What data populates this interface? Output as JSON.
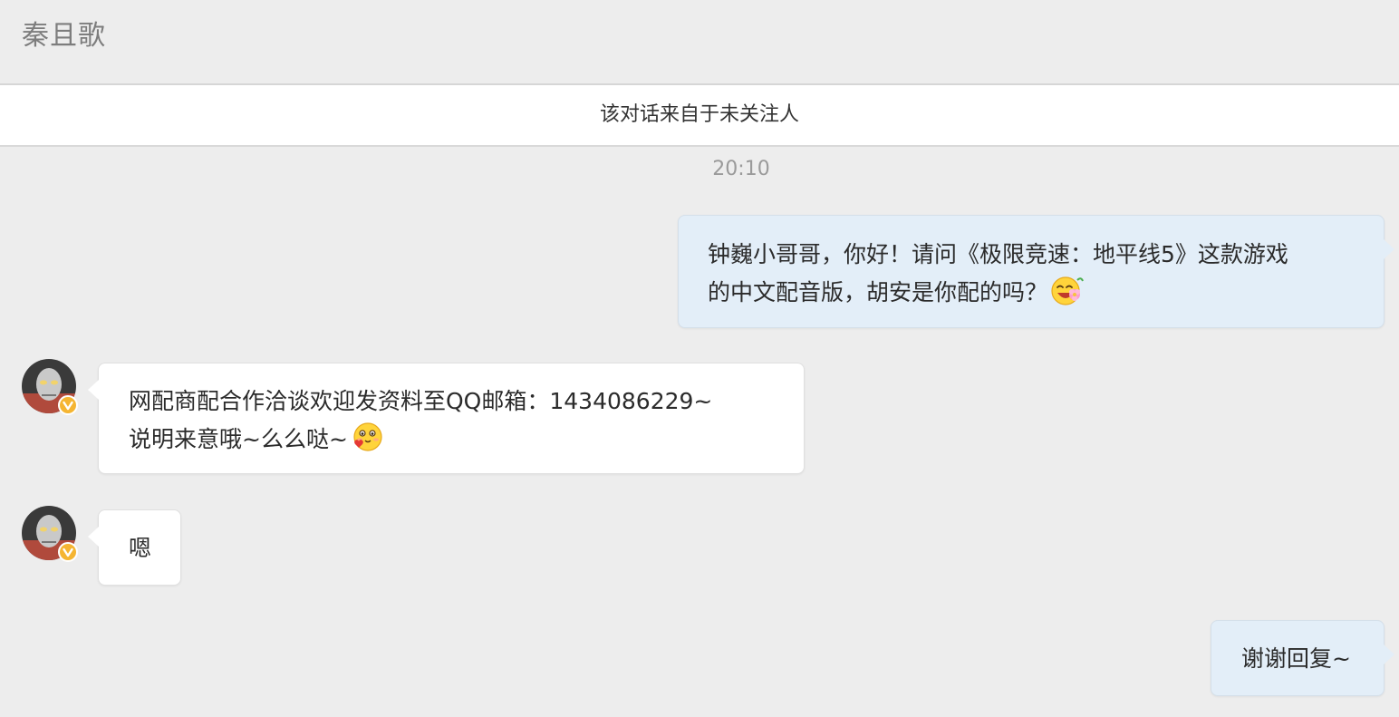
{
  "header": {
    "title": "秦且歌"
  },
  "notice": {
    "text": "该对话来自于未关注人"
  },
  "timestamp": "20:10",
  "messages": [
    {
      "direction": "outgoing",
      "lines": [
        "钟巍小哥哥，你好！请问《极限竞速：地平线5》这款游戏",
        "的中文配音版，胡安是你配的吗？"
      ],
      "emoji": "flower-grin-emoji"
    },
    {
      "direction": "incoming",
      "avatar": "user-avatar",
      "verified_badge": "verified-badge-icon",
      "lines": [
        "网配商配合作洽谈欢迎发资料至QQ邮箱：1434086229~",
        "说明来意哦~么么哒~"
      ],
      "emoji": "kiss-heart-emoji"
    },
    {
      "direction": "incoming",
      "avatar": "user-avatar",
      "verified_badge": "verified-badge-icon",
      "lines": [
        "嗯"
      ]
    },
    {
      "direction": "outgoing",
      "lines": [
        "谢谢回复~"
      ]
    }
  ],
  "colors": {
    "background": "#ededed",
    "outgoing_bubble": "#e3eef8",
    "incoming_bubble": "#ffffff",
    "verified_badge": "#f5b532"
  }
}
